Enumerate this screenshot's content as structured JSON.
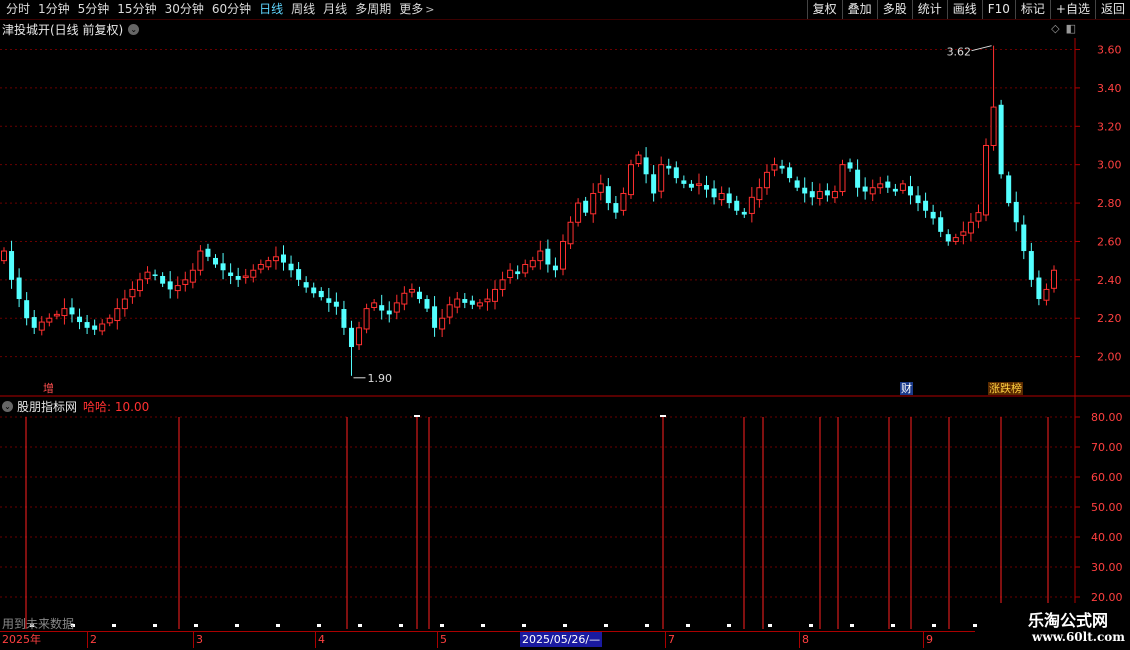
{
  "toolbar": {
    "periods": [
      "分时",
      "1分钟",
      "5分钟",
      "15分钟",
      "30分钟",
      "60分钟",
      "日线",
      "周线",
      "月线",
      "多周期"
    ],
    "active_period": "日线",
    "more_label": "更多",
    "right_buttons": [
      "复权",
      "叠加",
      "多股",
      "统计",
      "画线",
      "F10",
      "标记",
      "+自选",
      "返回"
    ]
  },
  "header": {
    "title": "津投城开(日线 前复权)"
  },
  "markers": {
    "zeng": "增",
    "cai": "财",
    "zhangdie": "涨跌榜"
  },
  "indicator": {
    "name": "股朋指标网",
    "value_text": "哈哈: 10.00"
  },
  "future_note": "用到未来数据",
  "dates": {
    "year": "2025年",
    "months": [
      "2",
      "3",
      "4",
      "5",
      "6",
      "7",
      "8",
      "9"
    ],
    "selected": "2025/05/26/—"
  },
  "watermark": {
    "line1": "乐淘公式网",
    "line2": "www.60lt.com"
  },
  "chart_data": {
    "type": "candlestick",
    "y_ticks": [
      "3.60",
      "3.40",
      "3.20",
      "3.00",
      "2.80",
      "2.60",
      "2.40",
      "2.20",
      "2.00"
    ],
    "ylim": [
      1.8,
      3.66
    ],
    "annotations": {
      "high_label": "3.62",
      "low_label": "1.90"
    },
    "up_color": "#ff3030",
    "down_color": "#54ffff",
    "closes": [
      2.55,
      2.4,
      2.3,
      2.2,
      2.15,
      2.18,
      2.2,
      2.22,
      2.25,
      2.22,
      2.18,
      2.15,
      2.14,
      2.17,
      2.2,
      2.25,
      2.3,
      2.35,
      2.4,
      2.44,
      2.42,
      2.38,
      2.35,
      2.37,
      2.4,
      2.45,
      2.55,
      2.52,
      2.48,
      2.45,
      2.42,
      2.4,
      2.42,
      2.45,
      2.48,
      2.5,
      2.52,
      2.49,
      2.45,
      2.4,
      2.36,
      2.33,
      2.31,
      2.28,
      2.26,
      2.15,
      2.05,
      2.15,
      2.25,
      2.28,
      2.24,
      2.22,
      2.28,
      2.33,
      2.35,
      2.3,
      2.25,
      2.15,
      2.2,
      2.27,
      2.3,
      2.28,
      2.27,
      2.28,
      2.3,
      2.35,
      2.4,
      2.45,
      2.43,
      2.48,
      2.5,
      2.55,
      2.48,
      2.45,
      2.6,
      2.7,
      2.8,
      2.75,
      2.85,
      2.9,
      2.8,
      2.75,
      2.85,
      3.0,
      3.05,
      2.95,
      2.85,
      3.0,
      2.98,
      2.93,
      2.9,
      2.88,
      2.9,
      2.87,
      2.83,
      2.85,
      2.8,
      2.76,
      2.74,
      2.83,
      2.88,
      2.96,
      3.0,
      2.98,
      2.93,
      2.88,
      2.85,
      2.83,
      2.86,
      2.84,
      2.86,
      3.0,
      2.98,
      2.88,
      2.86,
      2.88,
      2.9,
      2.88,
      2.86,
      2.9,
      2.84,
      2.8,
      2.76,
      2.72,
      2.65,
      2.6,
      2.62,
      2.65,
      2.7,
      2.75,
      3.1,
      3.3,
      2.95,
      2.8,
      2.7,
      2.55,
      2.4,
      2.3,
      2.35,
      2.45
    ]
  }
}
